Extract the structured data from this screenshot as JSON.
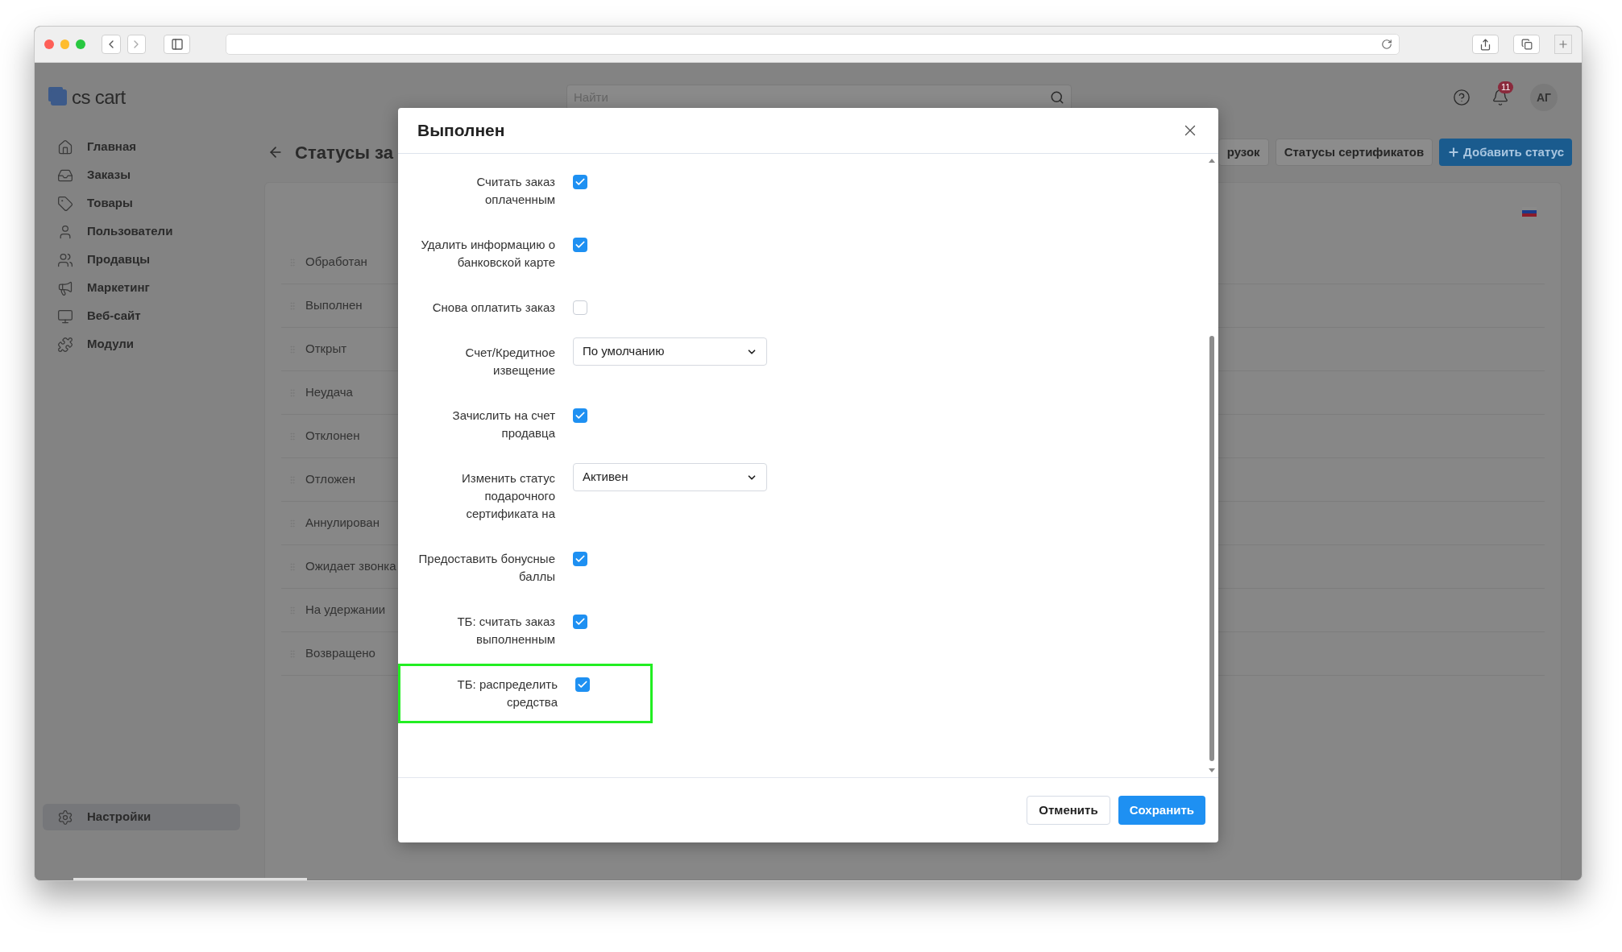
{
  "app": {
    "logo": "cs cart",
    "search": {
      "placeholder": "Найти"
    },
    "notifications": "11",
    "avatar": "АГ"
  },
  "sidebar": {
    "items": [
      {
        "label": "Главная",
        "selected": false
      },
      {
        "label": "Заказы",
        "selected": false
      },
      {
        "label": "Товары",
        "selected": false
      },
      {
        "label": "Пользователи",
        "selected": false
      },
      {
        "label": "Продавцы",
        "selected": false
      },
      {
        "label": "Маркетинг",
        "selected": false
      },
      {
        "label": "Веб-сайт",
        "selected": false
      },
      {
        "label": "Модули",
        "selected": false
      }
    ],
    "footer_item": {
      "label": "Настройки",
      "selected": true
    }
  },
  "page": {
    "title": "Статусы за",
    "buttons": [
      {
        "label": "рузок",
        "kind": "secondary"
      },
      {
        "label": "Статусы сертификатов",
        "kind": "secondary"
      },
      {
        "label": "Добавить статус",
        "kind": "primary"
      }
    ],
    "statuses": [
      "Обработан",
      "Выполнен",
      "Открыт",
      "Неудача",
      "Отклонен",
      "Отложен",
      "Аннулирован",
      "Ожидает звонка",
      "На удержании",
      "Возвращено"
    ]
  },
  "modal": {
    "title": "Выполнен",
    "fields": [
      {
        "label": "Считать заказ оплаченным",
        "kind": "checkbox",
        "checked": true,
        "highlighted": false
      },
      {
        "label": "Удалить информацию о банковской карте",
        "kind": "checkbox",
        "checked": true,
        "highlighted": false
      },
      {
        "label": "Снова оплатить заказ",
        "kind": "checkbox",
        "checked": false,
        "highlighted": false
      },
      {
        "label": "Счет/Кредитное извещение",
        "kind": "select",
        "value": "По умолчанию",
        "highlighted": false
      },
      {
        "label": "Зачислить на счет продавца",
        "kind": "checkbox",
        "checked": true,
        "highlighted": false
      },
      {
        "label": "Изменить статус подарочного сертификата на",
        "kind": "select",
        "value": "Активен",
        "highlighted": false
      },
      {
        "label": "Предоставить бонусные баллы",
        "kind": "checkbox",
        "checked": true,
        "highlighted": false
      },
      {
        "label": "ТБ: считать заказ выполненным",
        "kind": "checkbox",
        "checked": true,
        "highlighted": false
      },
      {
        "label": "ТБ: распределить средства",
        "kind": "checkbox",
        "checked": true,
        "highlighted": true
      }
    ],
    "buttons": [
      {
        "label": "Отменить",
        "kind": "secondary"
      },
      {
        "label": "Сохранить",
        "kind": "primary"
      }
    ]
  }
}
